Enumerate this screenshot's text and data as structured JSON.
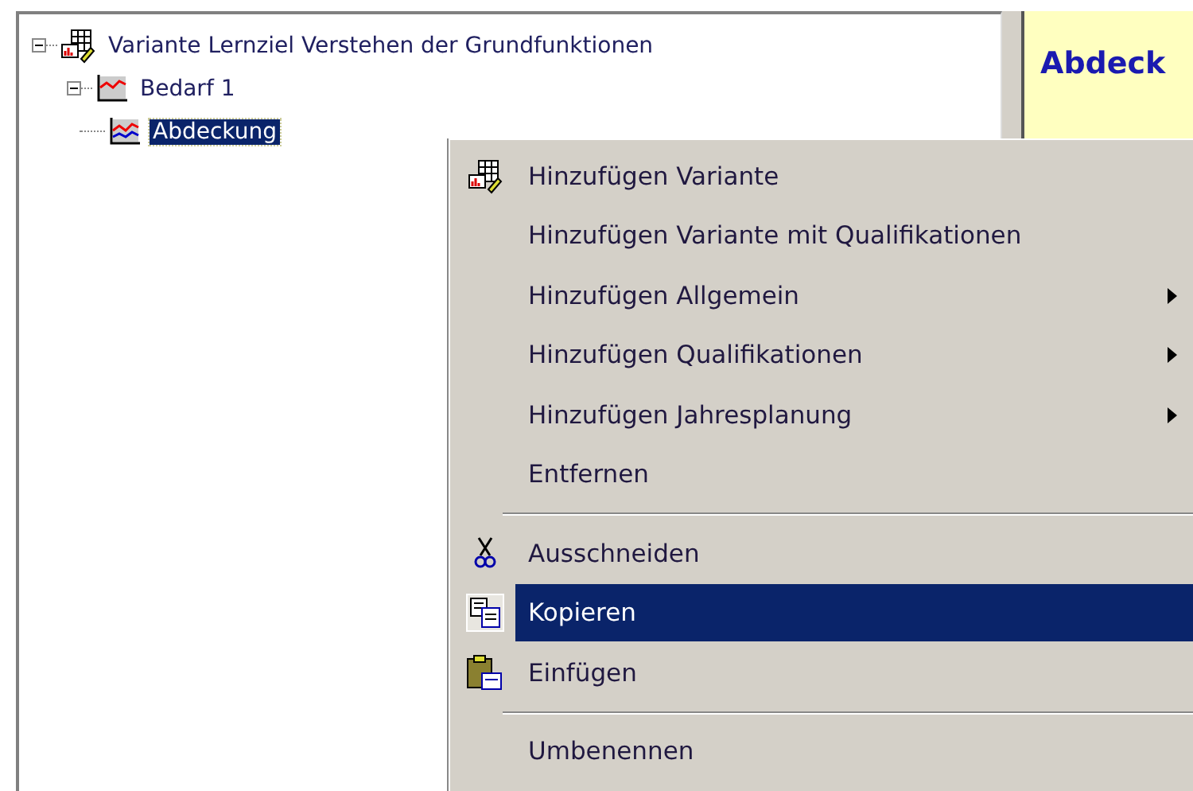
{
  "tree": [
    {
      "label": "Variante Lernziel Verstehen der Grundfunktionen",
      "expanded": true,
      "selected": false,
      "children": [
        {
          "label": "Bedarf 1",
          "expanded": true,
          "selected": false,
          "children": [
            {
              "label": "Abdeckung",
              "selected": true
            }
          ]
        }
      ]
    }
  ],
  "detail": {
    "heading": "Abdeck"
  },
  "context_menu": [
    {
      "kind": "item",
      "label": "Hinzufügen Variante",
      "submenu": false,
      "selected": false
    },
    {
      "kind": "item",
      "label": "Hinzufügen Variante mit Qualifikationen",
      "submenu": false,
      "selected": false
    },
    {
      "kind": "item",
      "label": "Hinzufügen Allgemein",
      "submenu": true,
      "selected": false
    },
    {
      "kind": "item",
      "label": "Hinzufügen Qualifikationen",
      "submenu": true,
      "selected": false
    },
    {
      "kind": "item",
      "label": "Hinzufügen Jahresplanung",
      "submenu": true,
      "selected": false
    },
    {
      "kind": "item",
      "label": "Entfernen",
      "submenu": false,
      "selected": false
    },
    {
      "kind": "separator"
    },
    {
      "kind": "item",
      "label": "Ausschneiden",
      "submenu": false,
      "selected": false
    },
    {
      "kind": "item",
      "label": "Kopieren",
      "submenu": false,
      "selected": true
    },
    {
      "kind": "item",
      "label": "Einfügen",
      "submenu": false,
      "selected": false
    },
    {
      "kind": "separator"
    },
    {
      "kind": "item",
      "label": "Umbenennen",
      "submenu": false,
      "selected": false
    }
  ]
}
